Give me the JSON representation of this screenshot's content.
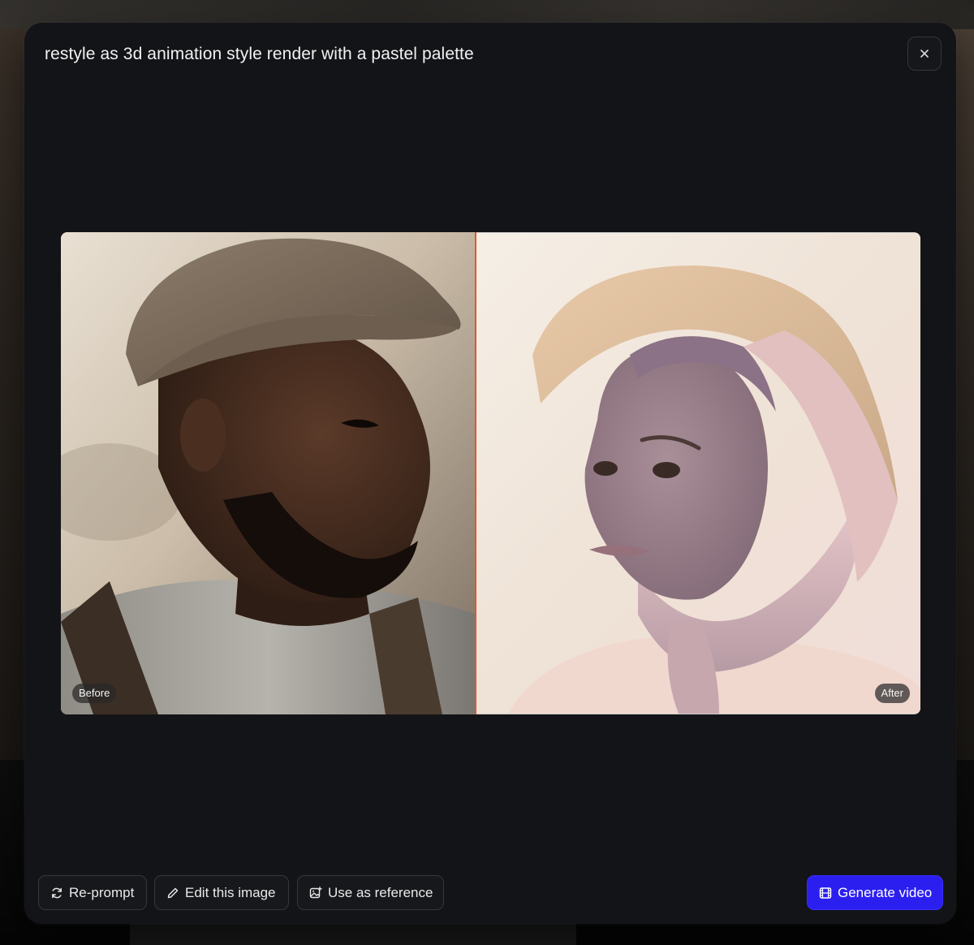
{
  "modal": {
    "title": "restyle as 3d animation style render with a pastel palette",
    "close_icon": "close-icon"
  },
  "comparison": {
    "before_label": "Before",
    "after_label": "After",
    "divider_position_fraction": 0.483,
    "divider_color": "#e4552f"
  },
  "footer": {
    "reprompt_label": "Re-prompt",
    "reprompt_icon": "refresh-icon",
    "edit_label": "Edit this image",
    "edit_icon": "pencil-icon",
    "reference_label": "Use as reference",
    "reference_icon": "image-add-icon",
    "generate_label": "Generate video",
    "generate_icon": "film-icon",
    "generate_color": "#2b1ff0"
  }
}
